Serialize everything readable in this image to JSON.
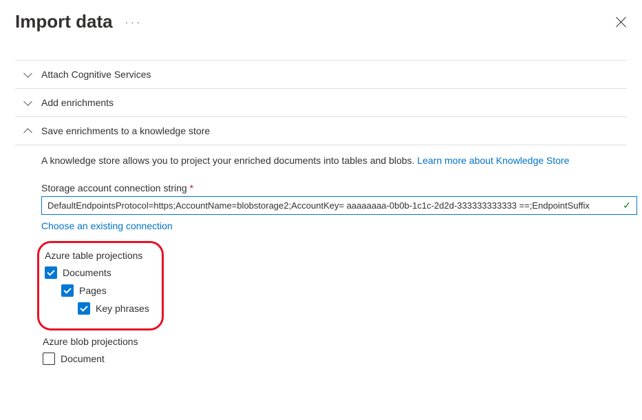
{
  "header": {
    "title": "Import data"
  },
  "accordions": {
    "attach": "Attach Cognitive Services",
    "enrich": "Add enrichments",
    "save": "Save enrichments to a knowledge store"
  },
  "knowledgeStore": {
    "desc": "A knowledge store allows you to project your enriched documents into tables and blobs. ",
    "learn_link": "Learn more about Knowledge Store",
    "conn_label": "Storage account connection string",
    "conn_value": "DefaultEndpointsProtocol=https;AccountName=blobstorage2;AccountKey= aaaaaaaa-0b0b-1c1c-2d2d-333333333333 ==;EndpointSuffix",
    "choose_link": "Choose an existing connection"
  },
  "tableProjections": {
    "title": "Azure table projections",
    "documents": "Documents",
    "pages": "Pages",
    "keyphrases": "Key phrases"
  },
  "blobProjections": {
    "title": "Azure blob projections",
    "document": "Document"
  }
}
